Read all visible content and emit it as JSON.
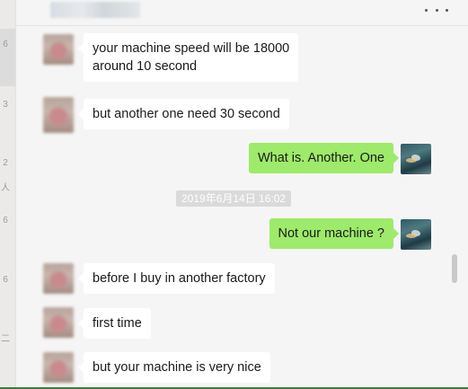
{
  "header": {
    "more_icon": "more-horizontal-icon"
  },
  "left_edge": {
    "marks": [
      "6",
      "3",
      "2",
      "人",
      "6",
      "6",
      "二"
    ]
  },
  "chat": {
    "messages": [
      {
        "side": "left",
        "lines": [
          "your machine speed will be 18000",
          "around 10 second"
        ]
      },
      {
        "side": "left",
        "lines": [
          "but another one need 30 second"
        ]
      },
      {
        "side": "right",
        "lines": [
          "What is. Another. One"
        ]
      },
      {
        "side": "right",
        "lines": [
          "Not our machine ?"
        ]
      },
      {
        "side": "left",
        "lines": [
          "before I buy in another factory"
        ]
      },
      {
        "side": "left",
        "lines": [
          "first time"
        ]
      },
      {
        "side": "left",
        "lines": [
          "but your machine is very nice"
        ]
      }
    ],
    "timestamp": "2019年6月14日 16:02"
  },
  "colors": {
    "my_bubble": "#9eea6a",
    "their_bubble": "#ffffff",
    "background": "#f5f5f5"
  }
}
